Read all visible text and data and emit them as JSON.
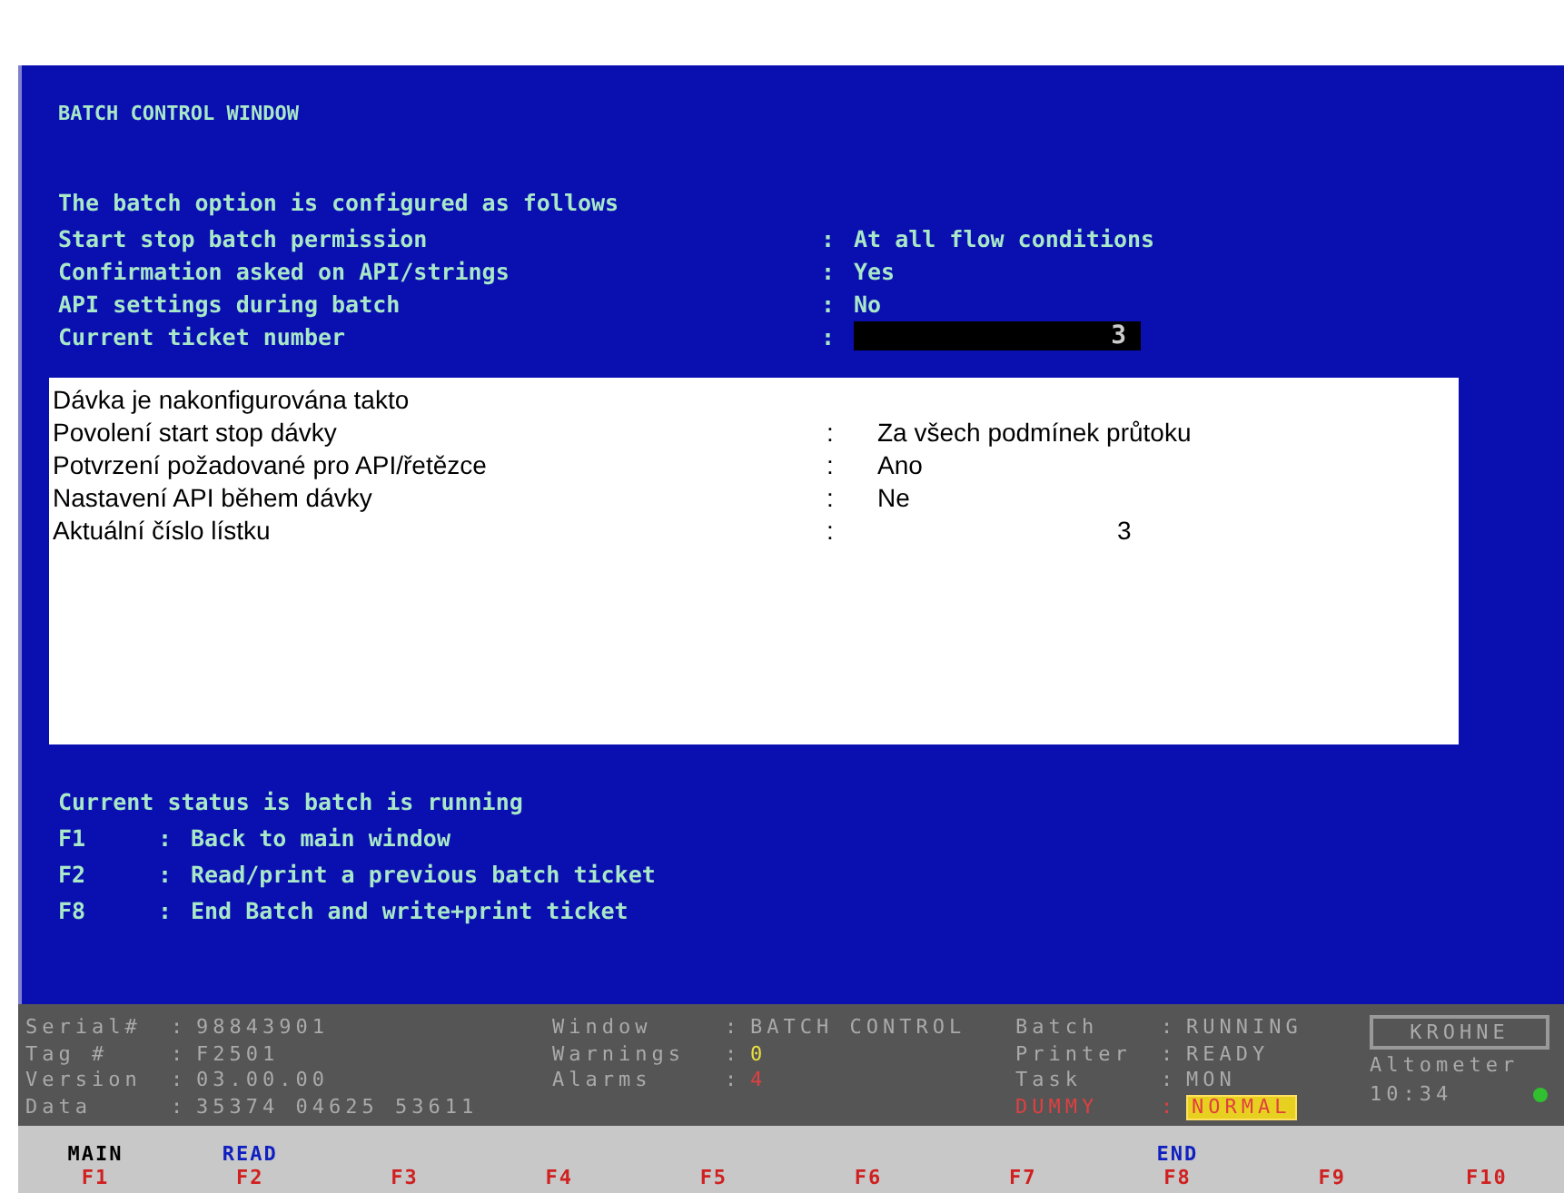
{
  "title": "BATCH CONTROL WINDOW",
  "config": {
    "intro": "The batch option is configured as follows",
    "rows": [
      {
        "label": "Start stop batch permission",
        "separator": ":",
        "value": "At all flow conditions",
        "kind": "text"
      },
      {
        "label": "Confirmation asked on API/strings",
        "separator": ":",
        "value": "Yes",
        "kind": "text"
      },
      {
        "label": "API settings during batch",
        "separator": ":",
        "value": "No",
        "kind": "text"
      },
      {
        "label": "Current ticket number",
        "separator": ":",
        "value": "3",
        "kind": "field"
      }
    ]
  },
  "translation": {
    "intro": "Dávka je nakonfigurována takto",
    "rows": [
      {
        "label": "Povolení start stop dávky",
        "separator": ":",
        "value": "Za všech podmínek průtoku"
      },
      {
        "label": "Potvrzení požadované pro API/řetězce",
        "separator": ":",
        "value": "Ano"
      },
      {
        "label": "Nastavení API během dávky",
        "separator": ":",
        "value": "Ne"
      },
      {
        "label": "Aktuální číslo lístku",
        "separator": ":",
        "value": "3"
      }
    ]
  },
  "help": {
    "status": "Current status is batch is running",
    "keys": [
      {
        "key": "F1",
        "separator": ":",
        "text": "Back to main window"
      },
      {
        "key": "F2",
        "separator": ":",
        "text": "Read/print a previous batch ticket"
      },
      {
        "key": "F8",
        "separator": ":",
        "text": "End Batch and write+print ticket"
      }
    ]
  },
  "status_bar": {
    "device": [
      {
        "label": "Serial#",
        "separator": ":",
        "value": "98843901"
      },
      {
        "label": "Tag   #",
        "separator": ":",
        "value": "F2501"
      },
      {
        "label": "Version",
        "separator": ":",
        "value": "03.00.00"
      },
      {
        "label": "Data",
        "separator": ":",
        "value": "35374 04625 53611"
      }
    ],
    "window": [
      {
        "label": "Window",
        "separator": ":",
        "value": "BATCH CONTROL"
      },
      {
        "label": "Warnings",
        "separator": ":",
        "value": "0",
        "color": "#e8e040"
      },
      {
        "label": "Alarms",
        "separator": ":",
        "value": "4",
        "color": "#e04040"
      }
    ],
    "state": [
      {
        "label": "Batch",
        "separator": ":",
        "value": "RUNNING",
        "kind": "text"
      },
      {
        "label": "Printer",
        "separator": ":",
        "value": "READY",
        "kind": "text"
      },
      {
        "label": "Task",
        "separator": ":",
        "value": "MON",
        "kind": "text"
      },
      {
        "label": "DUMMY",
        "separator": ":",
        "value": "NORMAL",
        "kind": "alert"
      }
    ],
    "brand": "KROHNE",
    "product": "Altometer",
    "time": "10:34"
  },
  "function_keys": [
    {
      "label": "MAIN",
      "key": "F1",
      "kind": "current"
    },
    {
      "label": "READ",
      "key": "F2",
      "kind": "action"
    },
    {
      "key": "F3",
      "kind": "blank"
    },
    {
      "key": "F4",
      "kind": "blank"
    },
    {
      "key": "F5",
      "kind": "blank"
    },
    {
      "key": "F6",
      "kind": "blank"
    },
    {
      "key": "F7",
      "kind": "blank"
    },
    {
      "label": "END",
      "key": "F8",
      "kind": "action"
    },
    {
      "key": "F9",
      "kind": "blank"
    },
    {
      "key": "F10",
      "kind": "blank"
    }
  ]
}
